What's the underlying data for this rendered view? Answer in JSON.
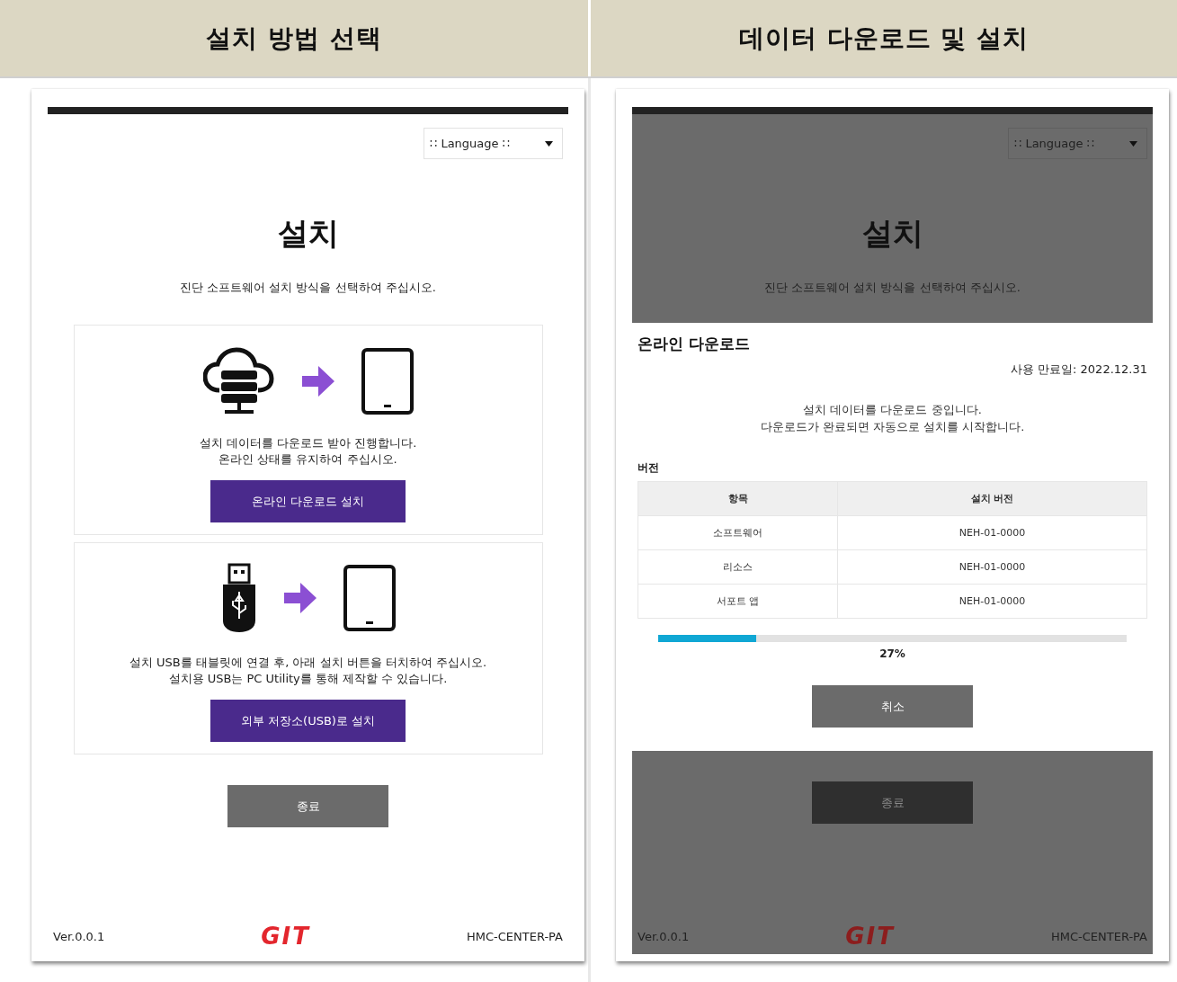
{
  "headers": [
    {
      "label": "설치 방법 선택"
    },
    {
      "label": "데이터 다운로드 및 설치"
    }
  ],
  "install_screen": {
    "language": "∷ Language ∷",
    "title": "설치",
    "subtitle": "진단 소프트웨어 설치 방식을 선택하여 주십시오.",
    "options": [
      {
        "kind": "online",
        "lines": [
          "설치 데이터를 다운로드 받아 진행합니다.",
          "온라인 상태를 유지하여 주십시오."
        ],
        "button": "온라인 다운로드 설치"
      },
      {
        "kind": "usb",
        "lines": [
          "설치 USB를 태블릿에 연결 후, 아래 설치 버튼을 터치하여 주십시오.",
          "설치용 USB는 PC Utility를 통해 제작할 수 있습니다."
        ],
        "button": "외부 저장소(USB)로 설치"
      }
    ],
    "exit_button": {
      "label": "종료",
      "disabled": false
    },
    "version": "Ver.0.0.1",
    "logo": "GIT",
    "device": "HMC-CENTER-PA"
  },
  "download_screen": {
    "language": "∷ Language ∷",
    "title": "설치",
    "subtitle": "진단 소프트웨어 설치 방식을 선택하여 주십시오.",
    "dialog": {
      "title": "온라인 다운로드",
      "expiry": "사용 만료일: 2022.12.31",
      "message": [
        "설치 데이터를 다운로드 중입니다.",
        "다운로드가 완료되면 자동으로 설치를 시작합니다."
      ],
      "section": "버전",
      "table": {
        "columns": [
          "항목",
          "설치 버전"
        ],
        "rows": [
          [
            "소프트웨어",
            "NEH-01-0000"
          ],
          [
            "리소스",
            "NEH-01-0000"
          ],
          [
            "서포트 앱",
            "NEH-01-0000"
          ]
        ]
      },
      "progress": {
        "level": 0.21,
        "reading": "27%"
      },
      "cancel_button": "취소"
    },
    "exit_button": {
      "label": "종료",
      "disabled": true
    },
    "version": "Ver.0.0.1",
    "logo": "GIT",
    "device": "HMC-CENTER-PA"
  }
}
